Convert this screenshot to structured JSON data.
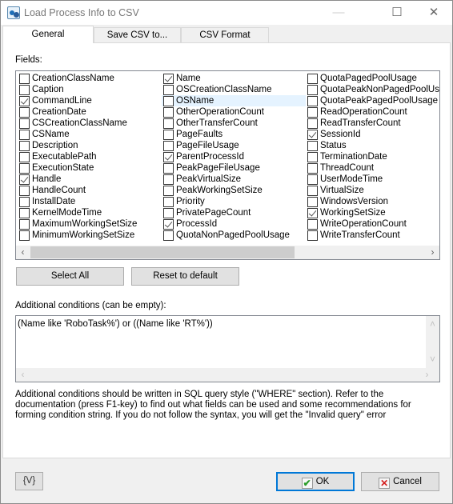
{
  "window": {
    "title": "Load Process Info to CSV",
    "minimize_icon": "minimize-icon",
    "maximize_icon": "maximize-icon",
    "close_icon": "close-icon"
  },
  "tabs": [
    {
      "label": "General",
      "active": true
    },
    {
      "label": "Save CSV to..."
    },
    {
      "label": "CSV Format"
    }
  ],
  "fields": {
    "label": "Fields:",
    "columns": [
      [
        {
          "name": "CreationClassName",
          "checked": false
        },
        {
          "name": "Caption",
          "checked": false
        },
        {
          "name": "CommandLine",
          "checked": true
        },
        {
          "name": "CreationDate",
          "checked": false
        },
        {
          "name": "CSCreationClassName",
          "checked": false
        },
        {
          "name": "CSName",
          "checked": false
        },
        {
          "name": "Description",
          "checked": false
        },
        {
          "name": "ExecutablePath",
          "checked": false
        },
        {
          "name": "ExecutionState",
          "checked": false
        },
        {
          "name": "Handle",
          "checked": true
        },
        {
          "name": "HandleCount",
          "checked": false
        },
        {
          "name": "InstallDate",
          "checked": false
        },
        {
          "name": "KernelModeTime",
          "checked": false
        },
        {
          "name": "MaximumWorkingSetSize",
          "checked": false
        },
        {
          "name": "MinimumWorkingSetSize",
          "checked": false
        }
      ],
      [
        {
          "name": "Name",
          "checked": true
        },
        {
          "name": "OSCreationClassName",
          "checked": false
        },
        {
          "name": "OSName",
          "checked": false,
          "focused": true
        },
        {
          "name": "OtherOperationCount",
          "checked": false
        },
        {
          "name": "OtherTransferCount",
          "checked": false
        },
        {
          "name": "PageFaults",
          "checked": false
        },
        {
          "name": "PageFileUsage",
          "checked": false
        },
        {
          "name": "ParentProcessId",
          "checked": true
        },
        {
          "name": "PeakPageFileUsage",
          "checked": false
        },
        {
          "name": "PeakVirtualSize",
          "checked": false
        },
        {
          "name": "PeakWorkingSetSize",
          "checked": false
        },
        {
          "name": "Priority",
          "checked": false
        },
        {
          "name": "PrivatePageCount",
          "checked": false
        },
        {
          "name": "ProcessId",
          "checked": true
        },
        {
          "name": "QuotaNonPagedPoolUsage",
          "checked": false
        }
      ],
      [
        {
          "name": "QuotaPagedPoolUsage",
          "checked": false
        },
        {
          "name": "QuotaPeakNonPagedPoolUsage",
          "checked": false
        },
        {
          "name": "QuotaPeakPagedPoolUsage",
          "checked": false
        },
        {
          "name": "ReadOperationCount",
          "checked": false
        },
        {
          "name": "ReadTransferCount",
          "checked": false
        },
        {
          "name": "SessionId",
          "checked": true
        },
        {
          "name": "Status",
          "checked": false
        },
        {
          "name": "TerminationDate",
          "checked": false
        },
        {
          "name": "ThreadCount",
          "checked": false
        },
        {
          "name": "UserModeTime",
          "checked": false
        },
        {
          "name": "VirtualSize",
          "checked": false
        },
        {
          "name": "WindowsVersion",
          "checked": false
        },
        {
          "name": "WorkingSetSize",
          "checked": true
        },
        {
          "name": "WriteOperationCount",
          "checked": false
        },
        {
          "name": "WriteTransferCount",
          "checked": false
        }
      ]
    ]
  },
  "buttons": {
    "select_all": "Select All",
    "reset": "Reset to default",
    "variables": "{V}",
    "ok": "OK",
    "cancel": "Cancel"
  },
  "conditions": {
    "label": "Additional conditions (can be empty):",
    "value": "(Name like 'RoboTask%') or ((Name like 'RT%'))"
  },
  "description": "Additional conditions should be written in SQL query style (\"WHERE\" section). Refer to the documentation (press F1-key) to find out what fields can be used and some recommendations for forming condition string. If you do not follow the syntax, you will get the \"Invalid query\" error",
  "colors": {
    "accent": "#0078d7",
    "ok_check": "#2a9d2a",
    "cancel_x": "#d42020"
  }
}
